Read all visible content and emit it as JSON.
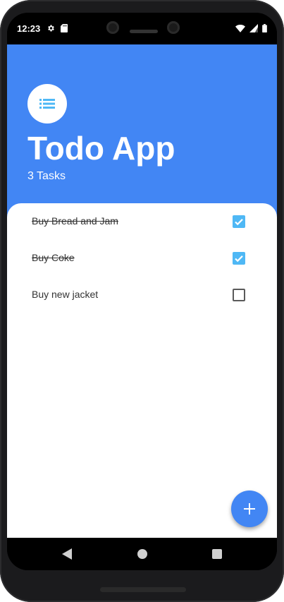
{
  "status_bar": {
    "time": "12:23",
    "left_icons": [
      "gear-icon",
      "sd-card-icon"
    ],
    "right_icons": [
      "wifi-icon",
      "signal-icon",
      "battery-icon"
    ]
  },
  "header": {
    "icon": "list-icon",
    "title": "Todo App",
    "subtitle": "3 Tasks"
  },
  "tasks": [
    {
      "label": "Buy Bread and Jam",
      "done": true
    },
    {
      "label": "Buy Coke",
      "done": true
    },
    {
      "label": "Buy new jacket",
      "done": false
    }
  ],
  "fab": {
    "icon": "plus-icon"
  },
  "nav_bar": {
    "buttons": [
      "back-icon",
      "home-icon",
      "recents-icon"
    ]
  },
  "colors": {
    "primary": "#4286f4",
    "checkbox_checked": "#4fb8f5",
    "list_icon": "#4fb8f5"
  }
}
